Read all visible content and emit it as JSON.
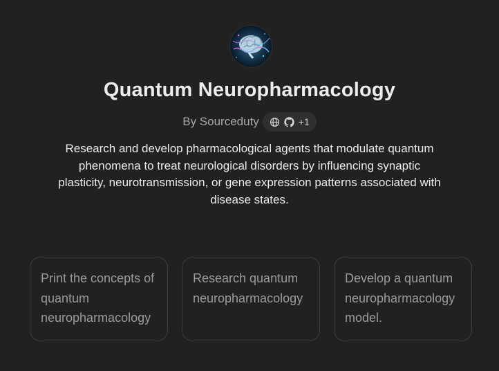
{
  "gpt": {
    "title": "Quantum Neuropharmacology",
    "author": "By Sourceduty",
    "link_icons": [
      "globe-icon",
      "github-icon"
    ],
    "links_extra": "+1",
    "description": "Research and develop pharmacological agents that modulate quantum phenomena to treat neurological disorders by influencing synaptic plasticity, neurotransmission, or gene expression patterns associated with disease states."
  },
  "conversation_starters": [
    "Print the concepts of quantum neuropharmacology",
    "Research quantum neuropharmacology",
    "Develop a quantum neuropharmacology model."
  ],
  "colors": {
    "background": "#212121",
    "text_primary": "#ececec",
    "text_secondary": "#a8a8a8",
    "starter_text": "#9b9b9b",
    "starter_border": "#3d3d3d",
    "chip_background": "#2f2f2f"
  }
}
